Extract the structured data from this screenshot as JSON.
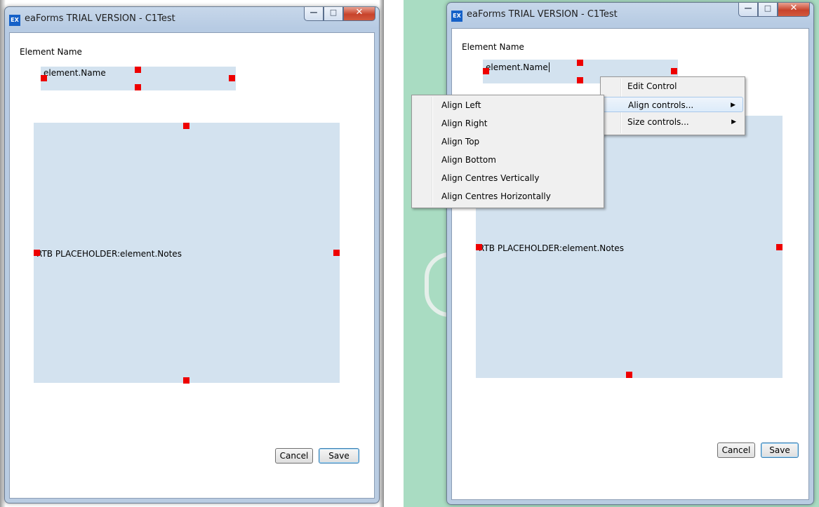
{
  "window_title": "eaForms TRIAL VERSION - C1Test",
  "app_icon": "EX",
  "caption": {
    "minimize": "—",
    "maximize": "□",
    "close": "✕"
  },
  "form": {
    "label": "Element Name",
    "name_field": "element.Name",
    "notes_field": "RTB PLACEHOLDER:element.Notes"
  },
  "buttons": {
    "cancel": "Cancel",
    "save": "Save"
  },
  "context_menu": {
    "items": [
      "Edit Control",
      "Align controls...",
      "Size controls..."
    ],
    "highlighted": "Align controls..."
  },
  "align_submenu": {
    "items": [
      "Align Left",
      "Align Right",
      "Align Top",
      "Align Bottom",
      "Align Centres Vertically",
      "Align Centres Horizontally"
    ]
  },
  "colors": {
    "selection_handle": "#ee0000",
    "field_bg": "#d3e2ef",
    "menu_bg": "#f0f0f0"
  }
}
